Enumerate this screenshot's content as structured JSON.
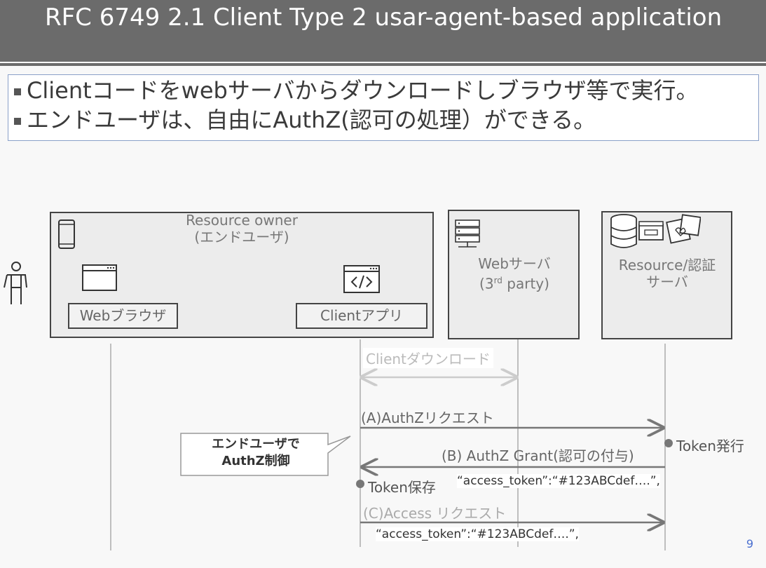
{
  "title": "RFC 6749 2.1 Client Type 2 usar-agent-based application",
  "bullets": [
    "Clientコードをwebサーバからダウンロードしブラウザ等で実行。",
    "エンドユーザは、自由にAuthZ(認可の処理）ができる。"
  ],
  "actors": {
    "resource_owner": {
      "line1": "Resource owner",
      "line2": "(エンドユーザ)"
    },
    "web_browser": "Webブラウザ",
    "client_app": "Clientアプリ",
    "web_server": {
      "line1": "Webサーバ",
      "line2_pre": "(3",
      "line2_sup": "rd",
      "line2_post": " party)"
    },
    "resource_server": {
      "line1": "Resource/認証",
      "line2": "サーバ"
    }
  },
  "messages": {
    "download": "Clientダウンロード",
    "a": "(A)AuthZリクエスト",
    "b": "(B) AuthZ Grant(認可の付与)",
    "c": "(C)Access リクエスト"
  },
  "notes": {
    "token_issue": "Token発行",
    "token_save": "Token保存",
    "access_token_b": "“access_token”:“#123ABCdef….”,",
    "access_token_c": "“access_token”:“#123ABCdef….”,"
  },
  "callout": {
    "line1": "エンドユーザで",
    "line2": "AuthZ制御"
  },
  "page_number": "9",
  "colors": {
    "title_bg": "#6b6b6b",
    "box_border": "#8aa0c8",
    "arrow": "#777777",
    "arrow_faint": "#cccccc",
    "page_number": "#4a6fd0"
  }
}
